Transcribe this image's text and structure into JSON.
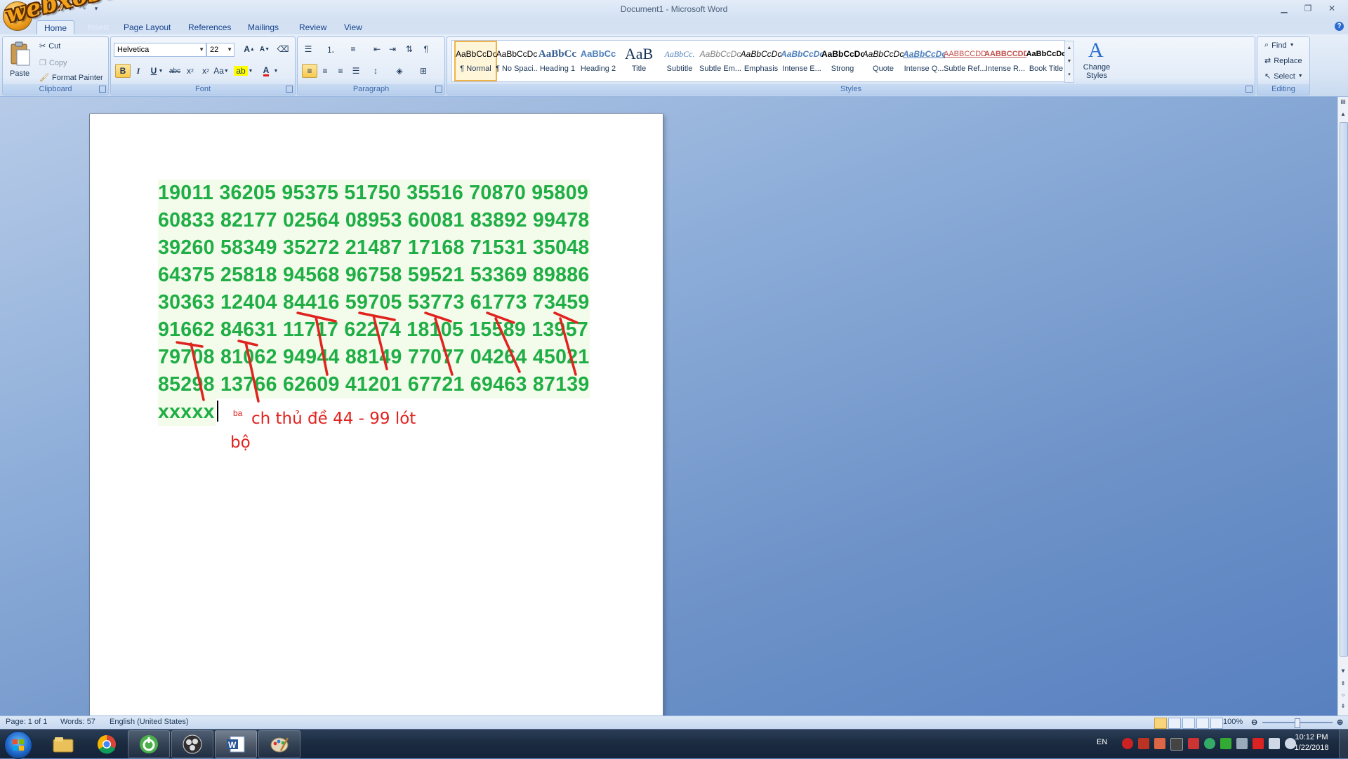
{
  "window": {
    "title": "Document1 - Microsoft Word"
  },
  "watermark": "webxoso.net",
  "quick_access": {
    "save": "save-icon",
    "undo": "undo-icon",
    "redo": "redo-icon",
    "customize": "customize-icon"
  },
  "tabs": [
    "Home",
    "Insert",
    "Page Layout",
    "References",
    "Mailings",
    "Review",
    "View"
  ],
  "clipboard": {
    "group": "Clipboard",
    "paste": "Paste",
    "cut": "Cut",
    "copy": "Copy",
    "format_painter": "Format Painter"
  },
  "font": {
    "group": "Font",
    "family": "Helvetica",
    "size": "22"
  },
  "paragraph": {
    "group": "Paragraph"
  },
  "styles": {
    "group": "Styles",
    "items": [
      {
        "sample": "AaBbCcDc",
        "name": "¶ Normal"
      },
      {
        "sample": "AaBbCcDc",
        "name": "¶ No Spaci..."
      },
      {
        "sample": "AaBbCc",
        "name": "Heading 1"
      },
      {
        "sample": "AaBbCc",
        "name": "Heading 2"
      },
      {
        "sample": "AaB",
        "name": "Title"
      },
      {
        "sample": "AaBbCc.",
        "name": "Subtitle"
      },
      {
        "sample": "AaBbCcDc",
        "name": "Subtle Em..."
      },
      {
        "sample": "AaBbCcDc",
        "name": "Emphasis"
      },
      {
        "sample": "AaBbCcDc",
        "name": "Intense E..."
      },
      {
        "sample": "AaBbCcDc",
        "name": "Strong"
      },
      {
        "sample": "AaBbCcDc",
        "name": "Quote"
      },
      {
        "sample": "AaBbCcDc",
        "name": "Intense Q..."
      },
      {
        "sample": "AABBCCDD",
        "name": "Subtle Ref..."
      },
      {
        "sample": "AABBCCDD",
        "name": "Intense R..."
      },
      {
        "sample": "AaBbCcDc",
        "name": "Book Title"
      }
    ],
    "change_styles": "Change Styles"
  },
  "editing": {
    "group": "Editing",
    "find": "Find",
    "replace": "Replace",
    "select": "Select"
  },
  "document": {
    "lines": [
      "19011 36205 95375 51750 35516 70870 95809",
      "60833 82177 02564 08953 60081 83892 99478",
      "39260 58349 35272 21487 17168 71531 35048",
      "64375 25818 94568 96758 59521 53369 89886",
      "30363 12404 84416 59705 53773 61773 73459",
      "91662 84631 11717 62274 18105 15589 13957",
      "79708 81062 94944 88149 77077 04264 45021",
      "85298 13766 62609 41201 67721 69463 87139"
    ],
    "last_line": "xxxxx",
    "note_small": "ba",
    "note_main": "ch thủ đề 44 - 99 lót",
    "note_line2": "bộ",
    "highlight_color": "#1fae45",
    "annotation_color": "#e0231f"
  },
  "status": {
    "page": "Page: 1 of 1",
    "words": "Words: 57",
    "language": "English (United States)",
    "zoom": "100%"
  },
  "taskbar": {
    "apps": [
      "windows-explorer-icon",
      "chrome-icon",
      "coccoc-icon",
      "obs-icon",
      "word-icon",
      "paint-icon"
    ],
    "language": "EN",
    "time": "10:12 PM",
    "date": "1/22/2018"
  }
}
